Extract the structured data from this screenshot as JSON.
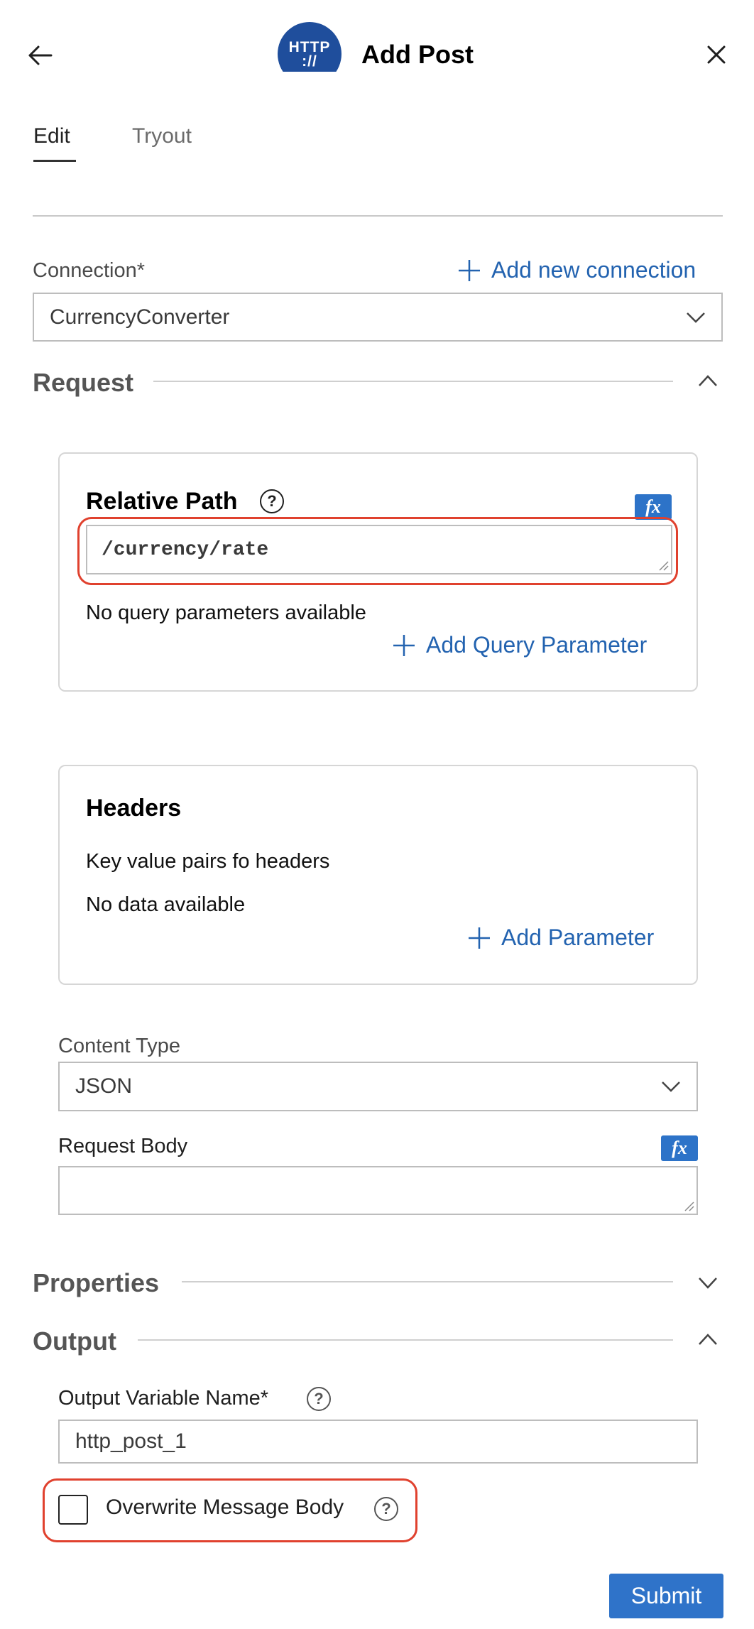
{
  "header": {
    "title": "Add Post",
    "logo_line1": "HTTP",
    "logo_line2": "://",
    "back_icon": "arrow-left-icon",
    "close_icon": "close-icon"
  },
  "tabs": [
    {
      "label": "Edit",
      "active": true
    },
    {
      "label": "Tryout",
      "active": false
    }
  ],
  "connection": {
    "label": "Connection*",
    "add_link": "Add new connection",
    "value": "CurrencyConverter"
  },
  "request": {
    "title": "Request",
    "relative_path": {
      "title": "Relative Path",
      "value": "/currency/rate",
      "empty_params": "No query parameters available",
      "add_link": "Add Query Parameter"
    },
    "headers": {
      "title": "Headers",
      "description": "Key value pairs fo headers",
      "empty": "No data available",
      "add_link": "Add Parameter"
    },
    "content_type": {
      "label": "Content Type",
      "value": "JSON"
    },
    "request_body": {
      "label": "Request Body",
      "value": ""
    },
    "fx_label": "fx"
  },
  "properties": {
    "title": "Properties"
  },
  "output": {
    "title": "Output",
    "variable_label": "Output Variable Name*",
    "variable_value": "http_post_1",
    "overwrite_label": "Overwrite Message Body",
    "overwrite_checked": false
  },
  "submit_label": "Submit",
  "colors": {
    "accent": "#2f73c9",
    "link": "#2363b0",
    "highlight": "#e0412e"
  }
}
